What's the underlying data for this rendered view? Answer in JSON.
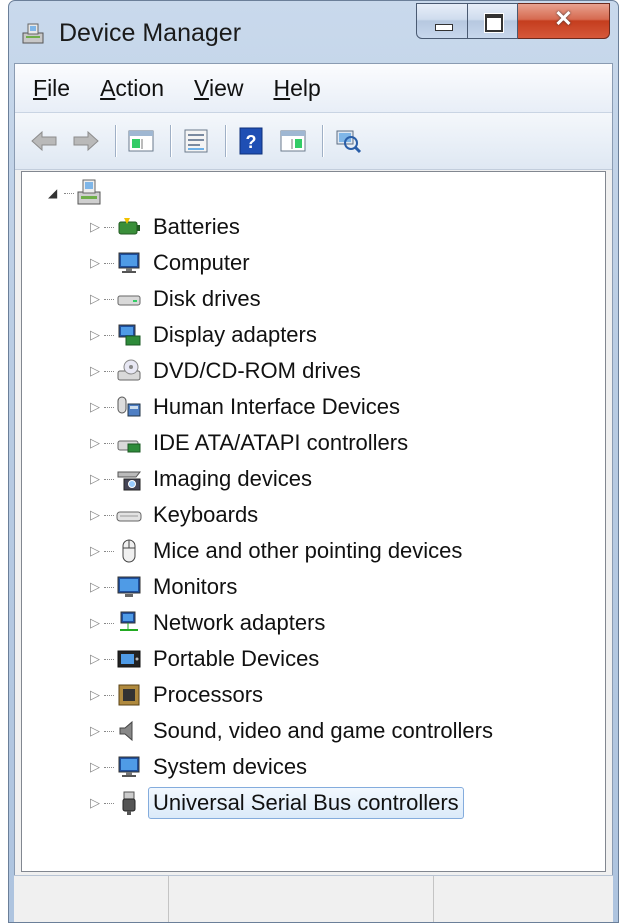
{
  "window": {
    "title": "Device Manager"
  },
  "menu": {
    "file": {
      "accel": "F",
      "rest": "ile"
    },
    "action": {
      "accel": "A",
      "rest": "ction"
    },
    "view": {
      "accel": "V",
      "rest": "iew"
    },
    "help": {
      "accel": "H",
      "rest": "elp"
    }
  },
  "toolbar": {
    "buttons": [
      "back-icon",
      "forward-icon",
      "show-hide-console-tree-icon",
      "properties-icon",
      "help-icon",
      "action-pane-icon",
      "scan-hardware-icon"
    ]
  },
  "tree": {
    "root_icon": "computer-root-icon",
    "items": [
      {
        "label": "Batteries",
        "icon": "battery-icon"
      },
      {
        "label": "Computer",
        "icon": "computer-icon"
      },
      {
        "label": "Disk drives",
        "icon": "disk-drive-icon"
      },
      {
        "label": "Display adapters",
        "icon": "display-adapter-icon"
      },
      {
        "label": "DVD/CD-ROM drives",
        "icon": "dvd-drive-icon"
      },
      {
        "label": "Human Interface Devices",
        "icon": "hid-icon"
      },
      {
        "label": "IDE ATA/ATAPI controllers",
        "icon": "ide-controller-icon"
      },
      {
        "label": "Imaging devices",
        "icon": "imaging-device-icon"
      },
      {
        "label": "Keyboards",
        "icon": "keyboard-icon"
      },
      {
        "label": "Mice and other pointing devices",
        "icon": "mouse-icon"
      },
      {
        "label": "Monitors",
        "icon": "monitor-icon"
      },
      {
        "label": "Network adapters",
        "icon": "network-adapter-icon"
      },
      {
        "label": "Portable Devices",
        "icon": "portable-device-icon"
      },
      {
        "label": "Processors",
        "icon": "processor-icon"
      },
      {
        "label": "Sound, video and game controllers",
        "icon": "speaker-icon"
      },
      {
        "label": "System devices",
        "icon": "system-device-icon"
      },
      {
        "label": "Universal Serial Bus controllers",
        "icon": "usb-icon"
      }
    ],
    "selected_index": 16
  },
  "colors": {
    "selection_border": "#84acdd",
    "title_close": "#c43d1e"
  }
}
